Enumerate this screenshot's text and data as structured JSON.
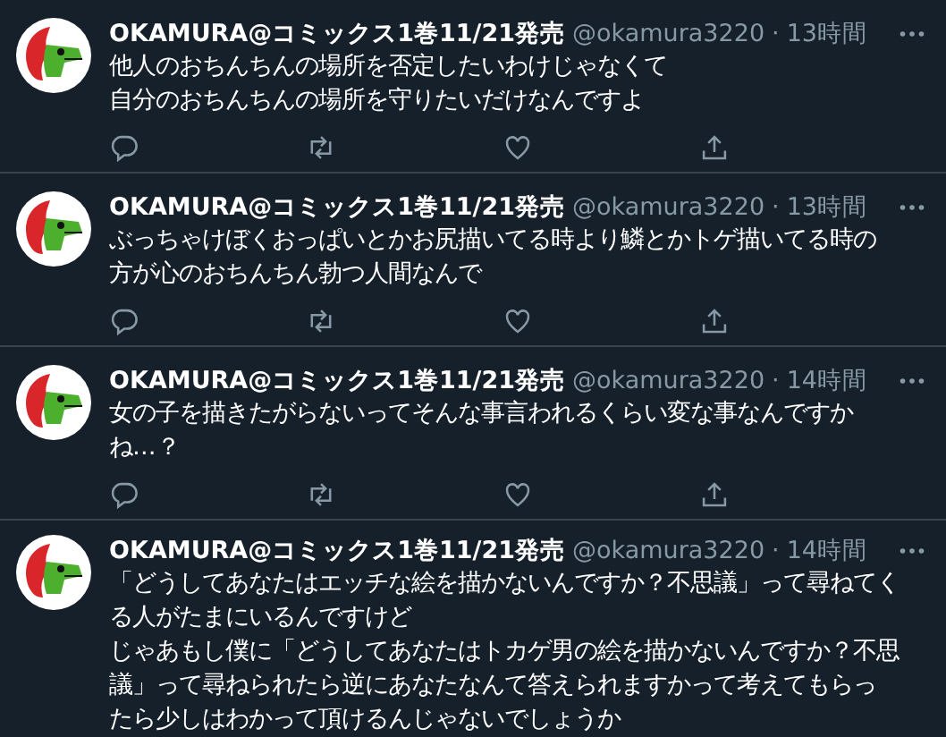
{
  "tweets": [
    {
      "name": "OKAMURA@コミックス1巻11/21発売",
      "handle": "@okamura3220",
      "separator": "·",
      "time": "13時間",
      "lines": [
        "他人のおちんちんの場所を否定したいわけじゃなくて",
        "自分のおちんちんの場所を守りたいだけなんですよ"
      ],
      "actions_visible": true
    },
    {
      "name": "OKAMURA@コミックス1巻11/21発売",
      "handle": "@okamura3220",
      "separator": "·",
      "time": "13時間",
      "lines": [
        "ぶっちゃけぼくおっぱいとかお尻描いてる時より鱗とかトゲ描いてる時の",
        "方が心のおちんちん勃つ人間なんで"
      ],
      "actions_visible": true
    },
    {
      "name": "OKAMURA@コミックス1巻11/21発売",
      "handle": "@okamura3220",
      "separator": "·",
      "time": "14時間",
      "lines": [
        "女の子を描きたがらないってそんな事言われるくらい変な事なんですか",
        "ね…？"
      ],
      "actions_visible": true
    },
    {
      "name": "OKAMURA@コミックス1巻11/21発売",
      "handle": "@okamura3220",
      "separator": "·",
      "time": "14時間",
      "lines": [
        "「どうしてあなたはエッチな絵を描かないんですか？不思議」って尋ねてく",
        "る人がたまにいるんですけど",
        "じゃあもし僕に「どうしてあなたはトカゲ男の絵を描かないんですか？不思",
        "議」って尋ねられたら逆にあなたなんて答えられますかって考えてもらっ",
        "たら少しはわかって頂けるんじゃないでしょうか"
      ],
      "actions_visible": false
    }
  ]
}
